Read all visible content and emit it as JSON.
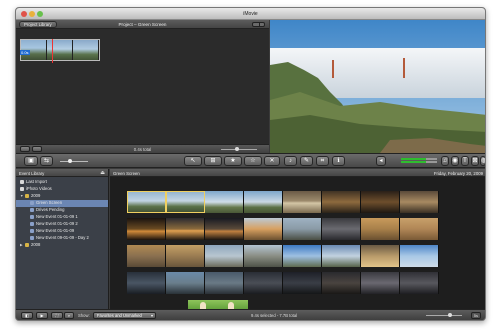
{
  "window": {
    "title": "iMovie"
  },
  "project": {
    "library_button": "Project Library",
    "title": "Project – Green Screen",
    "total": "0.4s total",
    "clip_badge": "0.0s"
  },
  "toolbar": {
    "colors": {
      "accent": "#f0d060",
      "meter_green": "#2fbd2f"
    }
  },
  "event_library": {
    "header": "Event Library",
    "items": [
      {
        "label": "Last Import",
        "kind": "event"
      },
      {
        "label": "iPhoto Videos",
        "kind": "event"
      },
      {
        "label": "2009",
        "kind": "folder"
      },
      {
        "label": "Green Screen",
        "kind": "clip",
        "selected": true
      },
      {
        "label": "Drives Pending",
        "kind": "clip"
      },
      {
        "label": "New Event 01-01-09 1",
        "kind": "clip"
      },
      {
        "label": "New Event 01-01-09 2",
        "kind": "clip"
      },
      {
        "label": "New Event 01-01-09",
        "kind": "clip"
      },
      {
        "label": "New Event 09-01-09 - Day 2",
        "kind": "clip"
      },
      {
        "label": "2008",
        "kind": "folder"
      }
    ]
  },
  "event_browser": {
    "title": "Green Screen",
    "date": "Friday, February 20, 2009"
  },
  "bottom": {
    "show_label": "Show:",
    "filter": "Favorites and Unmarked",
    "status": "9.4s selected - 7.7B total",
    "seconds": "5s"
  }
}
